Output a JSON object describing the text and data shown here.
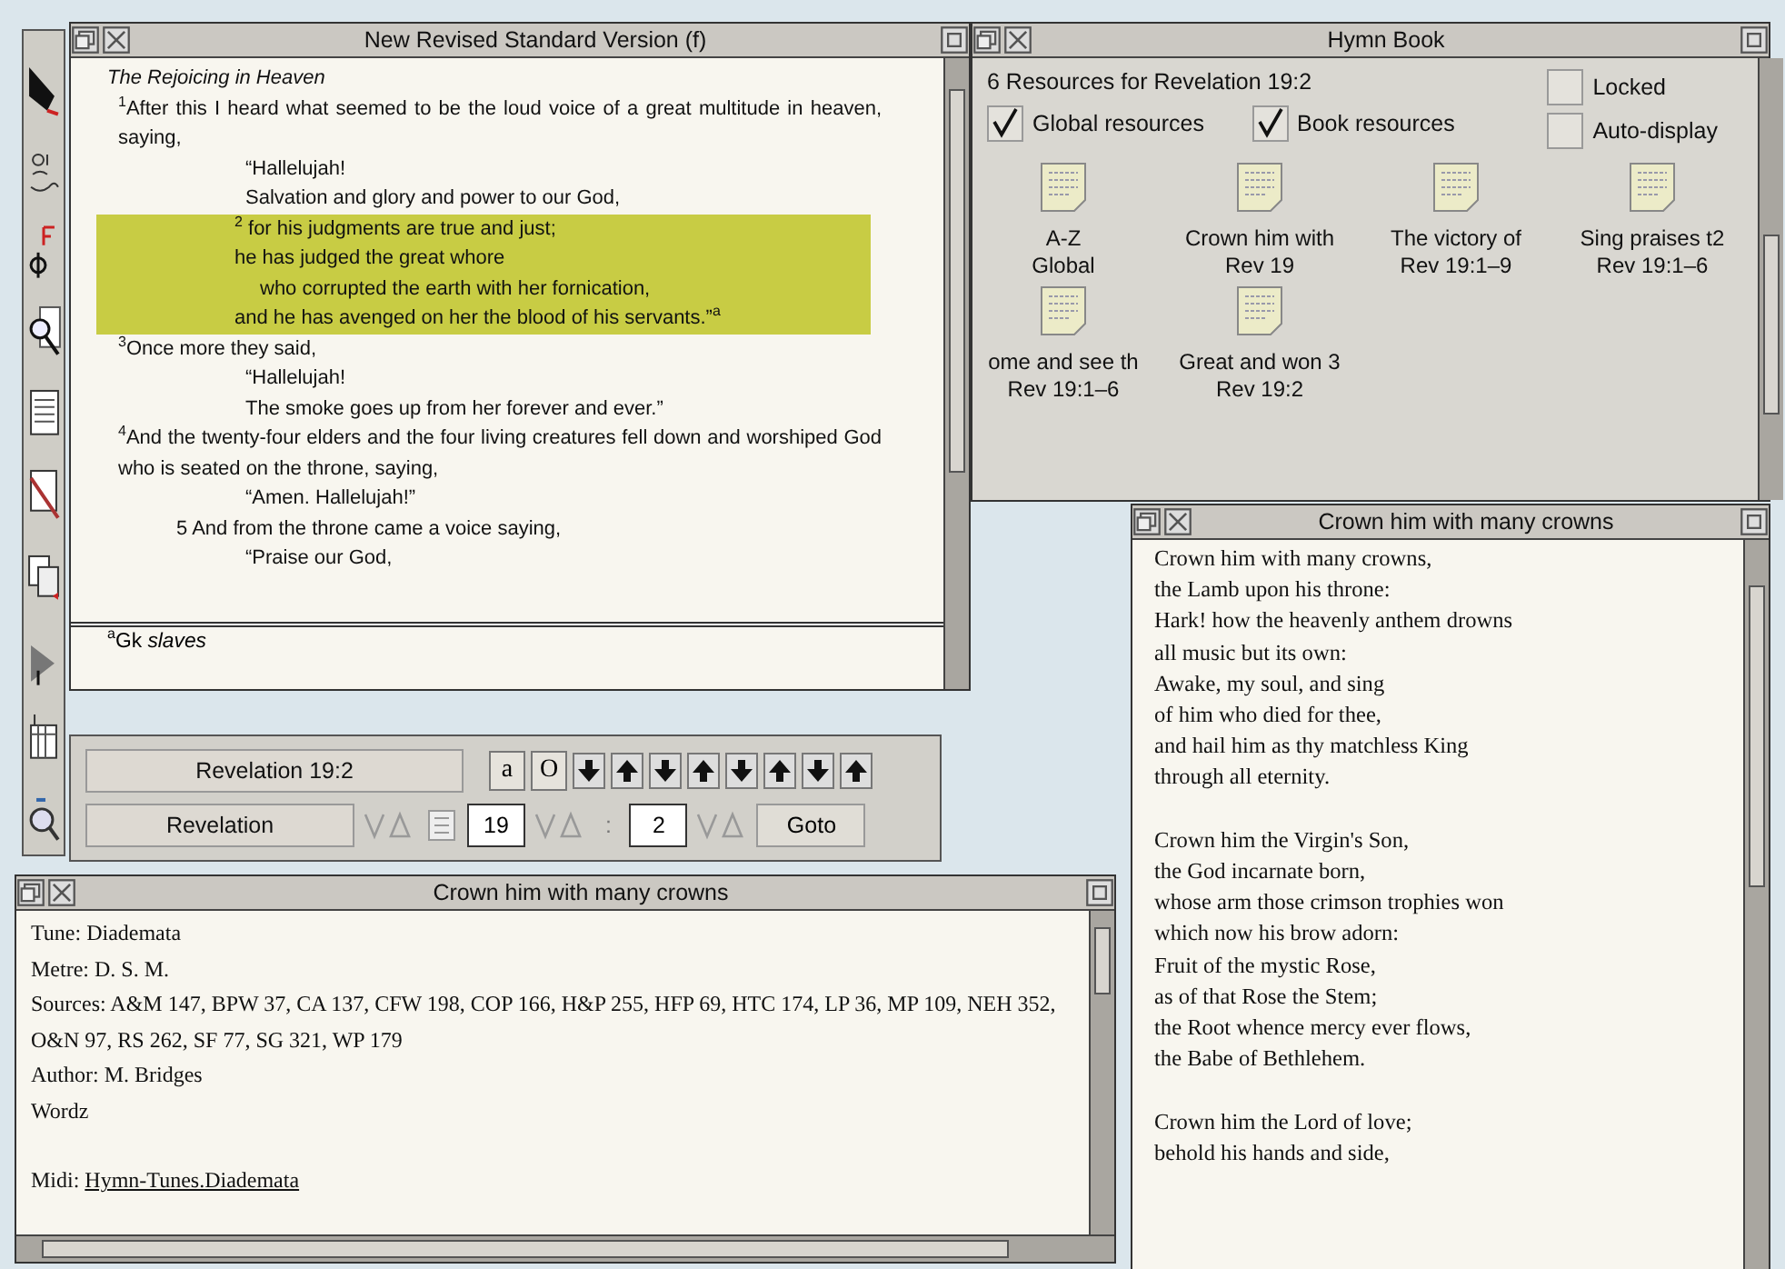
{
  "bible_window": {
    "title": "New Revised Standard Version (f)",
    "heading": "The Rejoicing in Heaven",
    "lines": [
      {
        "kind": "prose",
        "highlighted": false,
        "text": "$^{1}$After this I heard what seemed to be the loud voice of a great multitude in heaven, saying,"
      },
      {
        "kind": "poetry",
        "highlighted": false,
        "text": "“Hallelujah!"
      },
      {
        "kind": "poetry",
        "highlighted": false,
        "text": "Salvation and glory and power to our God,"
      },
      {
        "kind": "poetry",
        "highlighted": true,
        "text": "$^{2}$  for his judgments are true and just;"
      },
      {
        "kind": "poetry",
        "highlighted": true,
        "text": "he has judged the great whore"
      },
      {
        "kind": "poetry-deep",
        "highlighted": true,
        "text": "who corrupted the earth with her fornication,"
      },
      {
        "kind": "poetry",
        "highlighted": true,
        "text": "and he has avenged on her the blood of his servants.”$^{a}$"
      },
      {
        "kind": "prose",
        "highlighted": false,
        "text": "$^{3}$Once more they said,"
      },
      {
        "kind": "poetry",
        "highlighted": false,
        "text": "“Hallelujah!"
      },
      {
        "kind": "poetry",
        "highlighted": false,
        "text": "The smoke goes up from her forever and ever.”"
      },
      {
        "kind": "prose",
        "highlighted": false,
        "text": "$^{4}$And the twenty-four elders and the four living creatures fell down and worshiped God who is seated on the throne, saying,"
      },
      {
        "kind": "poetry",
        "highlighted": false,
        "text": "“Amen. Hallelujah!”"
      },
      {
        "kind": "verse-start",
        "highlighted": false,
        "text": "5 And from the throne came a voice saying,"
      },
      {
        "kind": "poetry",
        "highlighted": false,
        "text": "“Praise our God,"
      }
    ],
    "footnote": "$^{a}$Gk *slaves*"
  },
  "navigator": {
    "reference": "Revelation 19:2",
    "text_buttons": [
      "a",
      "O"
    ],
    "book": "Revelation",
    "chapter": "19",
    "separator": ":",
    "verse": "2",
    "goto": "Goto"
  },
  "hymn_book": {
    "title": "Hymn Book",
    "summary": "6 Resources for Revelation 19:2",
    "options": [
      {
        "label": "Global resources",
        "checked": true
      },
      {
        "label": "Book resources",
        "checked": true
      }
    ],
    "side_options": [
      {
        "label": "Locked",
        "checked": false
      },
      {
        "label": "Auto-display",
        "checked": false
      }
    ],
    "resources": [
      {
        "name": "A-Z",
        "ref": "Global"
      },
      {
        "name": "Crown him with",
        "ref": "Rev 19"
      },
      {
        "name": "The victory of",
        "ref": "Rev 19:1–9"
      },
      {
        "name": "Sing praises t2",
        "ref": "Rev 19:1–6"
      },
      {
        "name": "ome and see th",
        "ref": "Rev 19:1–6"
      },
      {
        "name": "Great and won 3",
        "ref": "Rev 19:2"
      }
    ]
  },
  "hymn_info": {
    "title": "Crown him with many crowns",
    "lines": [
      "Tune: Diademata",
      "Metre: D. S. M.",
      "Sources: A&M 147, BPW 37, CA 137, CFW 198, COP 166, H&P 255, HFP 69, HTC 174, LP 36, MP 109, NEH 352, O&N 97, RS 262, SF 77, SG 321, WP 179",
      "Author: M. Bridges",
      "Wordz"
    ],
    "midi_label": "Midi:",
    "midi_link": "Hymn-Tunes.Diademata"
  },
  "hymn_text": {
    "title": "Crown him with many crowns",
    "stanzas": [
      [
        "Crown him with many crowns,",
        "the Lamb upon his throne:",
        "Hark! how the heavenly anthem drowns",
        "all music but its own:",
        "Awake, my soul, and sing",
        "of him who died for thee,",
        "and hail him as thy matchless King",
        "through all eternity."
      ],
      [
        "Crown him the Virgin's Son,",
        "the God incarnate born,",
        "whose arm those crimson trophies won",
        "which now his brow adorn:",
        "Fruit of the mystic Rose,",
        "as of that Rose the Stem;",
        "the Root whence mercy ever flows,",
        "the Babe of Bethlehem."
      ],
      [
        "Crown him the Lord of love;",
        "behold his hands and side,"
      ]
    ]
  }
}
